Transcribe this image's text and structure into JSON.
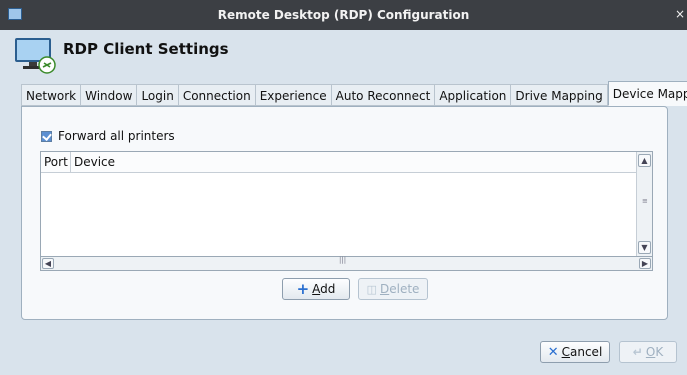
{
  "window": {
    "title": "Remote Desktop (RDP) Configuration",
    "close_glyph": "×"
  },
  "header": {
    "title": "RDP Client Settings",
    "icon": "monitor-link-icon"
  },
  "tabs": [
    {
      "label": "Network"
    },
    {
      "label": "Window"
    },
    {
      "label": "Login"
    },
    {
      "label": "Connection"
    },
    {
      "label": "Experience"
    },
    {
      "label": "Auto Reconnect"
    },
    {
      "label": "Application"
    },
    {
      "label": "Drive Mapping"
    },
    {
      "label": "Device Mapping",
      "active": true
    }
  ],
  "device_mapping": {
    "forward_printers": {
      "label": "Forward all printers",
      "checked": true
    },
    "table": {
      "columns": [
        "Port",
        "Device"
      ],
      "rows": []
    },
    "add_button": {
      "label": "Add",
      "mnemonic": "A",
      "rest": "dd",
      "enabled": true,
      "icon": "plus-icon"
    },
    "delete_button": {
      "label": "Delete",
      "mnemonic": "D",
      "rest": "elete",
      "enabled": false,
      "icon": "trash-icon"
    }
  },
  "footer": {
    "cancel_button": {
      "label": "Cancel",
      "mnemonic": "C",
      "rest": "ancel",
      "enabled": true,
      "icon": "x-icon"
    },
    "ok_button": {
      "label": "OK",
      "mnemonic": "O",
      "rest": "K",
      "enabled": false,
      "icon": "enter-icon"
    }
  },
  "colors": {
    "accent": "#2a6fd0",
    "titlebar": "#3c3f44",
    "window_bg": "#d9e3ec"
  }
}
